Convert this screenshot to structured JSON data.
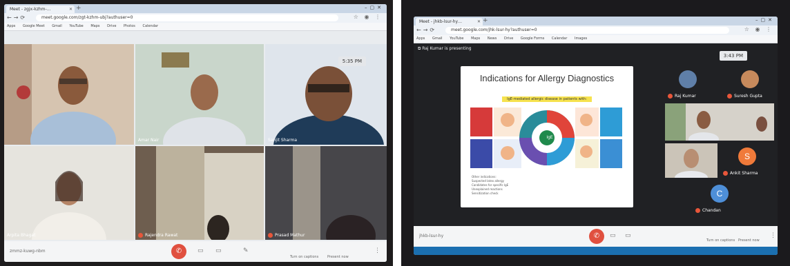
{
  "left_photo": {
    "browser": {
      "tab_title": "Meet - zgjx-kzhm-…",
      "url": "meet.google.com/zgt-kzhm-ubj?authuser=0",
      "bookmarks": [
        "Apps",
        "Google Meet",
        "Gmail",
        "YouTube",
        "Maps",
        "Drive",
        "Photos",
        "Calendar"
      ]
    },
    "clock": "5:35 PM",
    "participants": [
      {
        "name": ""
      },
      {
        "name": "Amar Nair"
      },
      {
        "name": "Sanjit Sharma"
      },
      {
        "name": "Arpita Bhagat"
      },
      {
        "name": "Rajendra Rawat"
      },
      {
        "name": "Prasad Mathur"
      }
    ],
    "meeting_code": "zmmz-kuwg-nbm",
    "controls": {
      "present_label": "Turn on captions",
      "chat_label": "Present now"
    }
  },
  "right_photo": {
    "browser": {
      "tab_title": "Meet - jhkb-lsur-hy…",
      "url": "meet.google.com/jhk-lsur-hy?authuser=0",
      "bookmarks": [
        "Apps",
        "Gmail",
        "YouTube",
        "Maps",
        "News",
        "Drive",
        "Google Forms",
        "Calendar",
        "Images"
      ]
    },
    "presenter": "Raj Kumar is presenting",
    "clock": "3:43 PM",
    "slide": {
      "title": "Indications for Allergy Diagnostics",
      "subtitle": "IgE-mediated allergic disease in patients with:",
      "center_label": "IgE",
      "bullets": [
        "Other indications:",
        "Suspected latex allergy",
        "Candidates for specific IgE",
        "Unexplained reactions",
        "Sensitization check"
      ]
    },
    "participants": [
      {
        "name": "Raj Kumar",
        "initial": ""
      },
      {
        "name": "Suresh Gupta",
        "initial": ""
      },
      {
        "name": "Ankit Sharma",
        "initial": "S"
      },
      {
        "name": "Chandan",
        "initial": "C"
      }
    ],
    "meeting_code": "jhkb-lsur-hy",
    "controls": {
      "captions_label": "Turn on captions",
      "present_label": "Present now"
    }
  }
}
